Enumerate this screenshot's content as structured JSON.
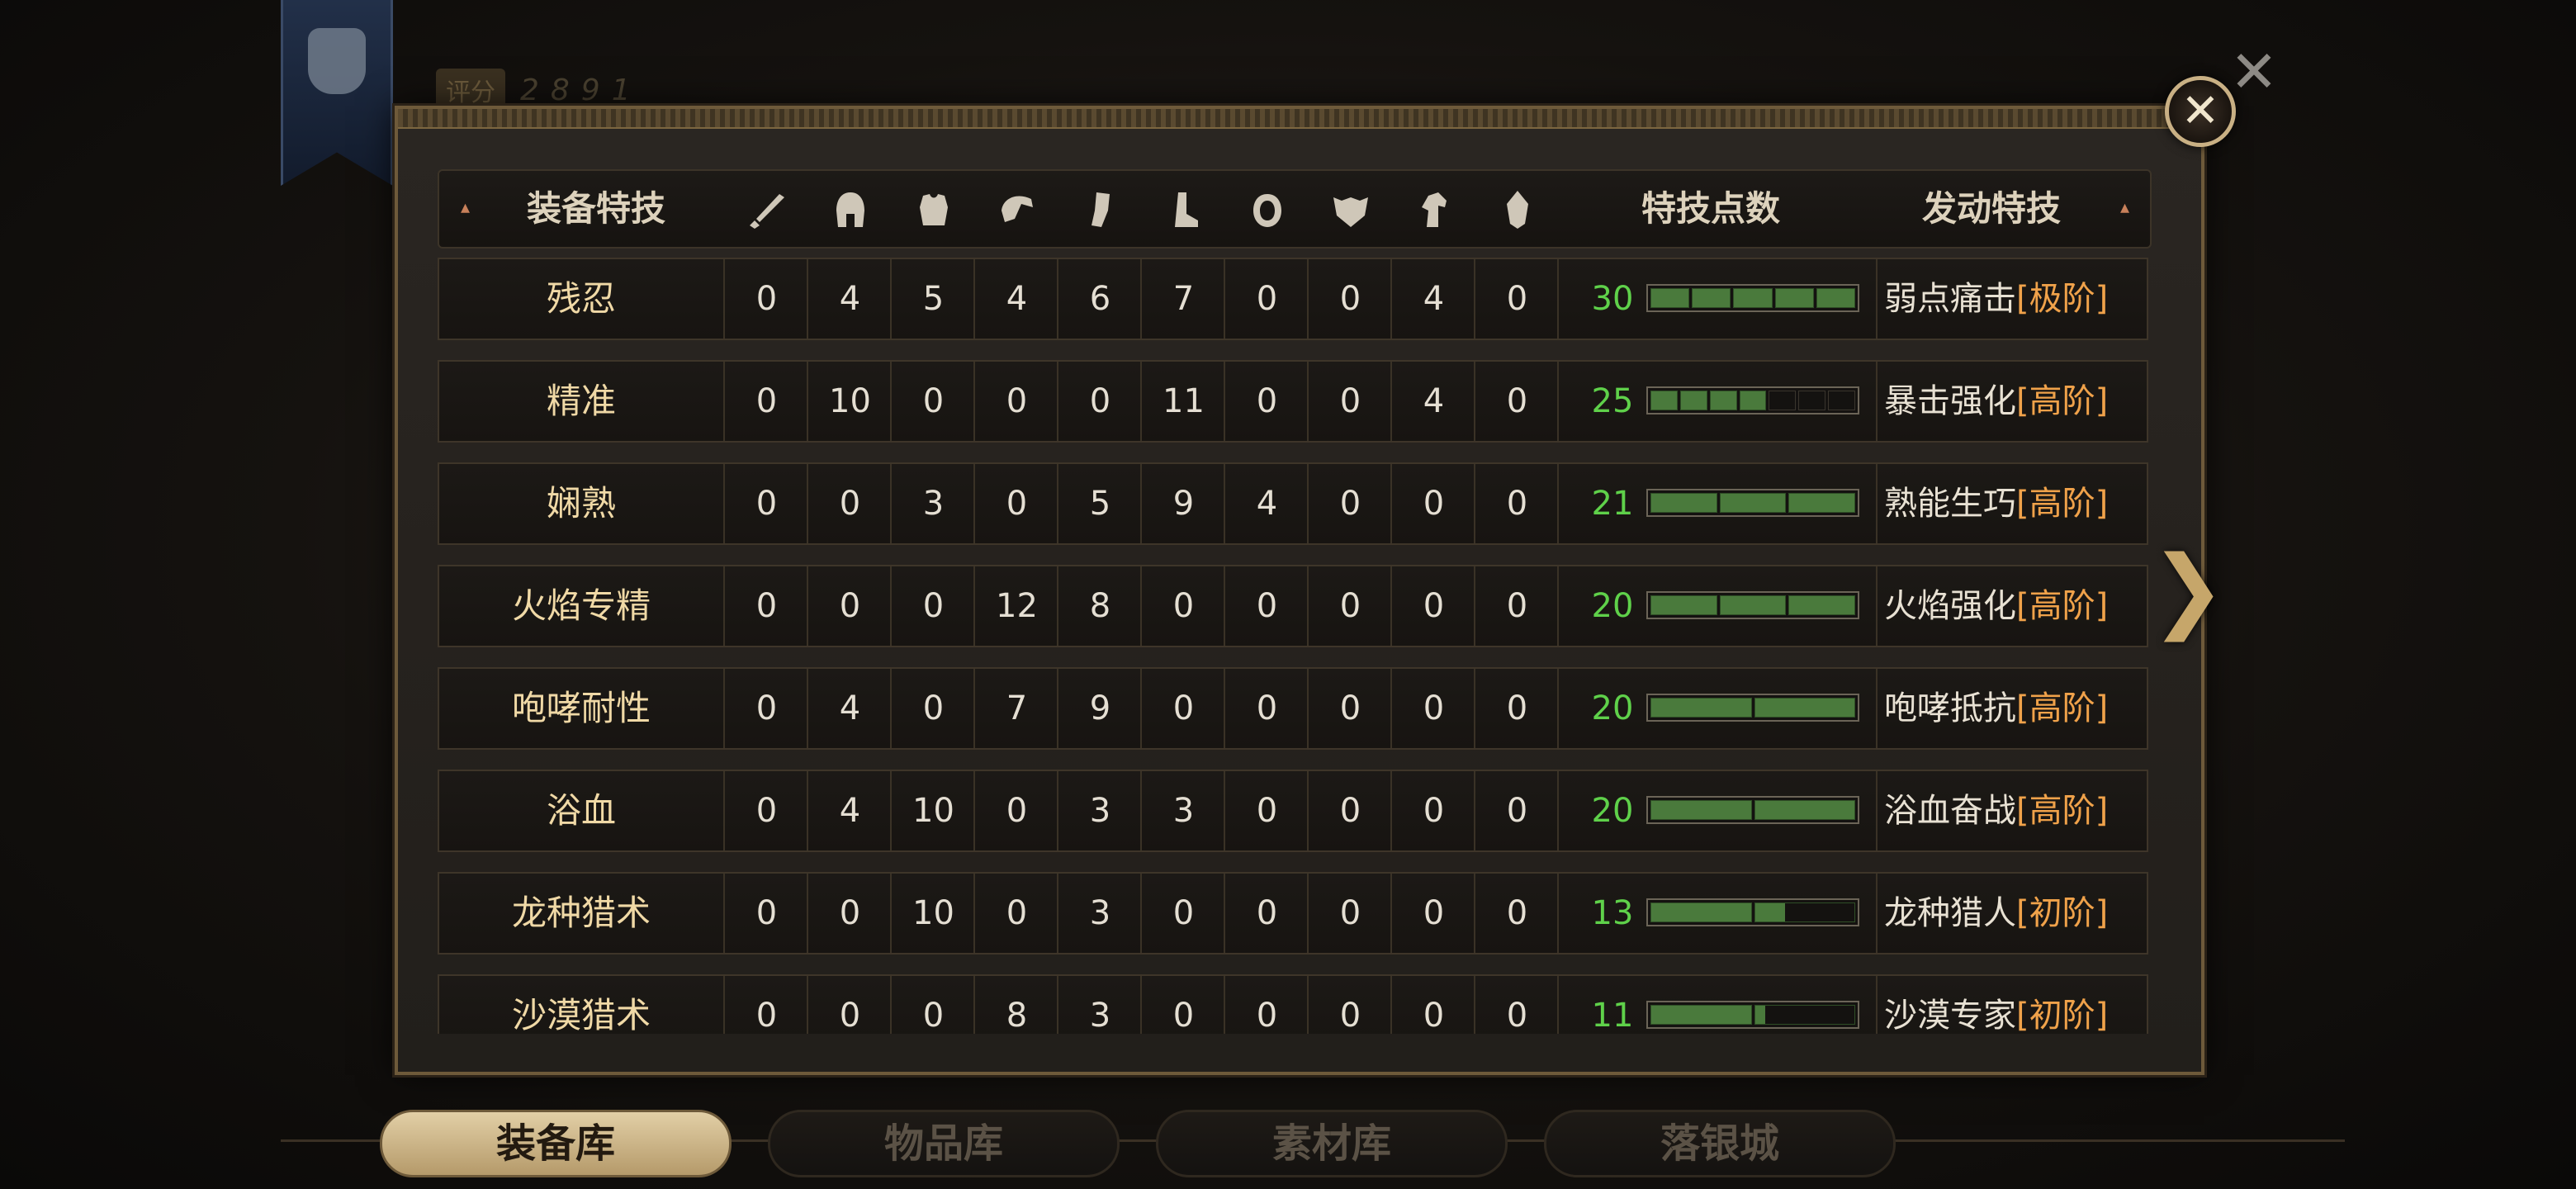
{
  "score": {
    "label": "评分",
    "value": "2891"
  },
  "close_symbol": "✕",
  "background_close_symbol": "✕",
  "next_symbol": "❯",
  "header": {
    "name_col": "装备特技",
    "points_col": "特技点数",
    "skill_col": "发动特技",
    "slot_icons": [
      "sword-icon",
      "helmet-icon",
      "chest-armor-icon",
      "shoulder-icon",
      "gloves-icon",
      "boots-icon",
      "ring-icon",
      "mask-icon",
      "horse-icon",
      "amulet-icon"
    ]
  },
  "rows": [
    {
      "name": "残忍",
      "values": [
        "0",
        "4",
        "5",
        "4",
        "6",
        "7",
        "0",
        "0",
        "4",
        "0"
      ],
      "points": "30",
      "bar": {
        "segments": 5,
        "filled": 5
      },
      "skill": "弱点痛击",
      "tier": "[极阶]"
    },
    {
      "name": "精准",
      "values": [
        "0",
        "10",
        "0",
        "0",
        "0",
        "11",
        "0",
        "0",
        "4",
        "0"
      ],
      "points": "25",
      "bar": {
        "segments": 7,
        "filled": 4
      },
      "skill": "暴击强化",
      "tier": "[高阶]"
    },
    {
      "name": "娴熟",
      "values": [
        "0",
        "0",
        "3",
        "0",
        "5",
        "9",
        "4",
        "0",
        "0",
        "0"
      ],
      "points": "21",
      "bar": {
        "segments": 3,
        "filled": 3
      },
      "skill": "熟能生巧",
      "tier": "[高阶]"
    },
    {
      "name": "火焰专精",
      "values": [
        "0",
        "0",
        "0",
        "12",
        "8",
        "0",
        "0",
        "0",
        "0",
        "0"
      ],
      "points": "20",
      "bar": {
        "segments": 3,
        "filled": 3
      },
      "skill": "火焰强化",
      "tier": "[高阶]"
    },
    {
      "name": "咆哮耐性",
      "values": [
        "0",
        "4",
        "0",
        "7",
        "9",
        "0",
        "0",
        "0",
        "0",
        "0"
      ],
      "points": "20",
      "bar": {
        "segments": 2,
        "filled": 2
      },
      "skill": "咆哮抵抗",
      "tier": "[高阶]"
    },
    {
      "name": "浴血",
      "values": [
        "0",
        "4",
        "10",
        "0",
        "3",
        "3",
        "0",
        "0",
        "0",
        "0"
      ],
      "points": "20",
      "bar": {
        "segments": 2,
        "filled": 2
      },
      "skill": "浴血奋战",
      "tier": "[高阶]"
    },
    {
      "name": "龙种猎术",
      "values": [
        "0",
        "0",
        "10",
        "0",
        "3",
        "0",
        "0",
        "0",
        "0",
        "0"
      ],
      "points": "13",
      "bar": {
        "segments": 2,
        "filled": 1.3
      },
      "skill": "龙种猎人",
      "tier": "[初阶]"
    },
    {
      "name": "沙漠猎术",
      "values": [
        "0",
        "0",
        "0",
        "8",
        "3",
        "0",
        "0",
        "0",
        "0",
        "0"
      ],
      "points": "11",
      "bar": {
        "segments": 2,
        "filled": 1.1
      },
      "skill": "沙漠专家",
      "tier": "[初阶]"
    }
  ],
  "tabs": [
    {
      "label": "装备库",
      "active": true
    },
    {
      "label": "物品库",
      "active": false
    },
    {
      "label": "素材库",
      "active": false
    },
    {
      "label": "落银城",
      "active": false
    }
  ]
}
